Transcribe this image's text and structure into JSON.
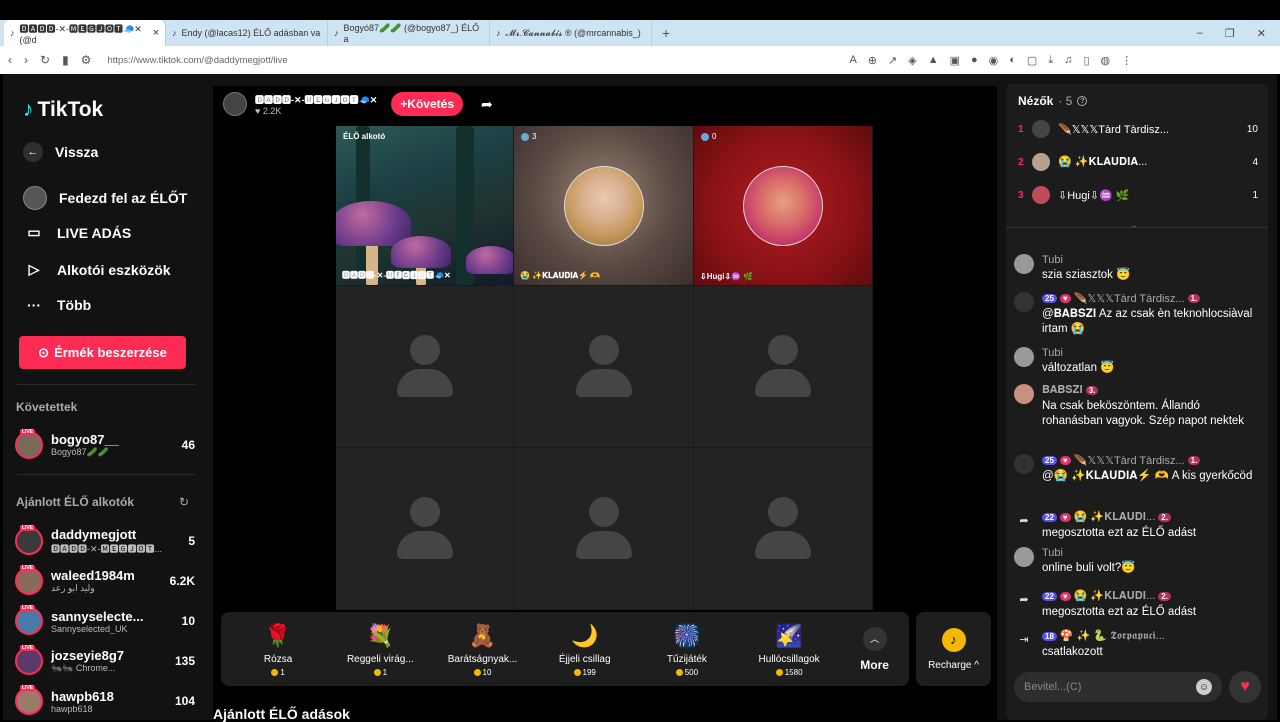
{
  "browser": {
    "tabs": [
      {
        "label": "🅳🅰🅳🅳-✕-🅼🅴🅶🅹🅾🆃🧢✕ (@d"
      },
      {
        "label": "Endy (@lacas12) ÉLŐ adásban va"
      },
      {
        "label": "Bogyó87🥒🥒 (@bogyo87_) ÉLŐ a"
      },
      {
        "label": "𝓜𝓻.𝓒𝓪𝓷𝓷𝓪𝓫𝓲𝓼 ® (@mrcannabis_)"
      }
    ],
    "url": "https://www.tiktok.com/@daddymegjott/live"
  },
  "sidebar": {
    "logo": "TikTok",
    "back": "Vissza",
    "nav": [
      {
        "label": "Fedezd fel az ÉLŐT"
      },
      {
        "label": "LIVE ADÁS"
      },
      {
        "label": "Alkotói eszközök"
      },
      {
        "label": "Több"
      }
    ],
    "coin_button": "Érmék beszerzése",
    "following_title": "Követettek",
    "following": [
      {
        "name": "bogyo87__",
        "sub": "Bogyó87🥒🥒",
        "count": "46"
      }
    ],
    "recommended_title": "Ajánlott ÉLŐ alkotók",
    "recommended": [
      {
        "name": "daddymegjott",
        "sub": "🅳🅰🅳🅳-✕-🅼🅴🅶🅹🅾🆃...",
        "count": "5"
      },
      {
        "name": "waleed1984m",
        "sub": "وليد ابو رعد",
        "count": "6.2K"
      },
      {
        "name": "sannyselecte...",
        "sub": "Sannyselected_UK",
        "count": "10"
      },
      {
        "name": "jozseyie8g7",
        "sub": "🐜🐜 Chrome...",
        "count": "135"
      },
      {
        "name": "hawpb618",
        "sub": "hawpb618",
        "count": "104"
      }
    ]
  },
  "host": {
    "name": "🅳🅰🅳🅳-✕-🅼🅴🅶🅹🅾🆃🧢✕",
    "likes": "♥ 2.2K",
    "follow": "+Követés"
  },
  "grid": {
    "host_tag": "ÉLŐ alkotó",
    "host_name": "🅳🅰🅳🅳-✕-🅼🅴🅶🅹🅾🆃🧢✕",
    "guest1_count": "3",
    "guest1_name": "😭 ✨𝐊𝐋𝐀𝐔𝐃𝐈𝐀⚡ 🫶",
    "guest2_count": "0",
    "guest2_name": "⇩Hugi⇩♒ 🌿"
  },
  "gifts": [
    {
      "name": "Rózsa",
      "price": "1",
      "icon": "🌹"
    },
    {
      "name": "Reggeli virág...",
      "price": "1",
      "icon": "💐"
    },
    {
      "name": "Barátságnyak...",
      "price": "10",
      "icon": "🧸"
    },
    {
      "name": "Éjjeli csillag",
      "price": "199",
      "icon": "🌙"
    },
    {
      "name": "Tűzijáték",
      "price": "500",
      "icon": "🎆"
    },
    {
      "name": "Hullócsillagok",
      "price": "1580",
      "icon": "🌠"
    }
  ],
  "more_label": "More",
  "recharge_label": "Recharge ^",
  "bottom_title": "Ajánlott ÉLŐ adások",
  "chat": {
    "viewers_title": "Nézők",
    "viewers_count": "· 5",
    "viewers": [
      {
        "rank": "1",
        "name": "🪶𝕏𝕏𝕏Tàrd Tàrdisz...",
        "count": "10"
      },
      {
        "rank": "2",
        "name": "😭 ✨𝐊𝐋𝐀𝐔𝐃𝐈𝐀...",
        "count": "4"
      },
      {
        "rank": "3",
        "name": "⇩Hugi⇩♒ 🌿",
        "count": "1"
      }
    ],
    "messages": [
      {
        "user": "Tubi",
        "text": "szia sziasztok 😇"
      },
      {
        "user": "🪶𝕏𝕏𝕏Tàrd Tàrdisz...",
        "b1": "25",
        "b2": "1.",
        "text": "@𝐁𝐀𝐁𝐒𝐙𝐈 Az az csak èn teknohlocsiàval irtam 😭"
      },
      {
        "user": "Tubi",
        "text": "változatlan 😇"
      },
      {
        "user": "𝐁𝐀𝐁𝐒𝐙𝐈",
        "b2": "3.",
        "text": "Na csak beköszöntem. Állandó rohanásban vagyok. Szép napot nektek"
      },
      {
        "user": "🪶𝕏𝕏𝕏Tàrd Tàrdisz...",
        "b1": "25",
        "b2": "1.",
        "text": "@😭 ✨𝐊𝐋𝐀𝐔𝐃𝐈𝐀⚡ 🫶 A kis gyerkőcöd"
      },
      {
        "user": "😭 ✨𝐊𝐋𝐀𝐔𝐃𝐈...",
        "b1": "22",
        "b2": "2.",
        "text": "megosztotta ezt az ÉLŐ adást"
      },
      {
        "user": "Tubi",
        "text": "online buli volt?😇"
      },
      {
        "user": "😭 ✨𝐊𝐋𝐀𝐔𝐃𝐈...",
        "b1": "22",
        "b2": "2.",
        "text": "megosztotta ezt az ÉLŐ adást"
      },
      {
        "user": "🍄 ✨ 🐍 𝕿𝖔𝖗𝖕𝖆𝖕𝖚𝖈𝖎...",
        "b1": "18",
        "text": "csatlakozott"
      }
    ],
    "input_placeholder": "Bevitel...(C)"
  }
}
